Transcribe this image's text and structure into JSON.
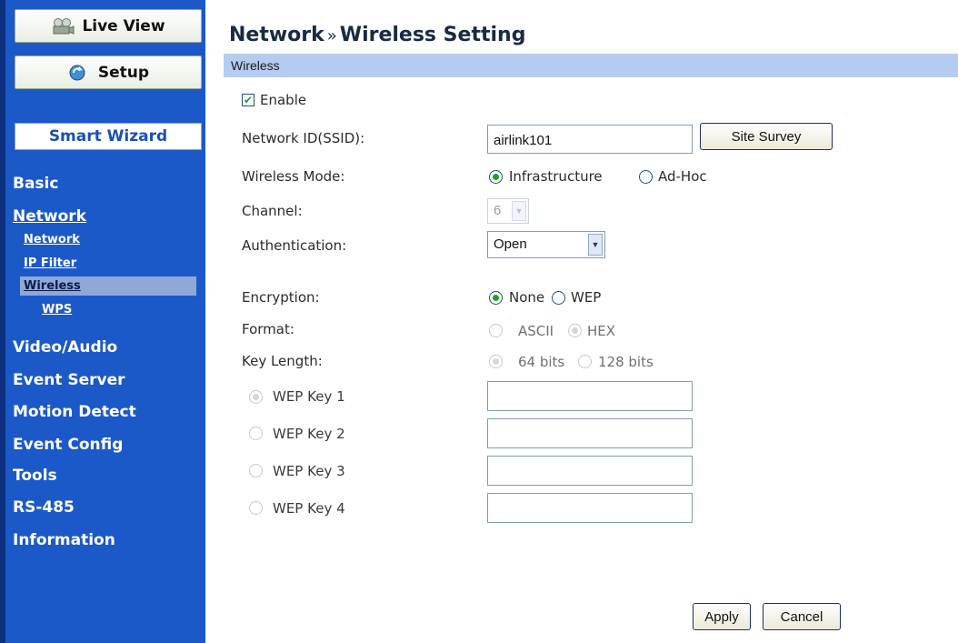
{
  "sidebar": {
    "live_view": "Live View",
    "setup": "Setup",
    "smart_wizard": "Smart Wizard",
    "nav": {
      "basic": "Basic",
      "network": "Network",
      "network_sub": "Network",
      "ip_filter": "IP Filter",
      "wireless": "Wireless",
      "wps": "WPS",
      "video_audio": "Video/Audio",
      "event_server": "Event Server",
      "motion_detect": "Motion Detect",
      "event_config": "Event Config",
      "tools": "Tools",
      "rs485": "RS-485",
      "information": "Information"
    },
    "selected": "Wireless"
  },
  "main": {
    "title_part1": "Network",
    "title_sep": "»",
    "title_part2": "Wireless Setting",
    "section": "Wireless",
    "enable_label": "Enable",
    "enable_checked": true,
    "ssid_label": "Network ID(SSID):",
    "ssid_value": "airlink101",
    "site_survey": "Site Survey",
    "mode_label": "Wireless Mode:",
    "mode_infra": "Infrastructure",
    "mode_adhoc": "Ad-Hoc",
    "mode_selected": "Infrastructure",
    "channel_label": "Channel:",
    "channel_value": "6",
    "auth_label": "Authentication:",
    "auth_value": "Open",
    "enc_label": "Encryption:",
    "enc_none": "None",
    "enc_wep": "WEP",
    "enc_selected": "None",
    "format_label": "Format:",
    "format_ascii": "ASCII",
    "format_hex": "HEX",
    "format_selected": "HEX",
    "keylen_label": "Key Length:",
    "keylen_64": "64 bits",
    "keylen_128": "128 bits",
    "keylen_selected": "64 bits",
    "wep_keys": [
      {
        "label": "WEP Key 1",
        "value": ""
      },
      {
        "label": "WEP Key 2",
        "value": ""
      },
      {
        "label": "WEP Key 3",
        "value": ""
      },
      {
        "label": "WEP Key 4",
        "value": ""
      }
    ],
    "wep_key_selected": "WEP Key 1",
    "apply": "Apply",
    "cancel": "Cancel"
  },
  "colors": {
    "sidebar_bg": "#1c59c8",
    "section_bar": "#b5cbf0",
    "radio_dot": "#21a121"
  }
}
